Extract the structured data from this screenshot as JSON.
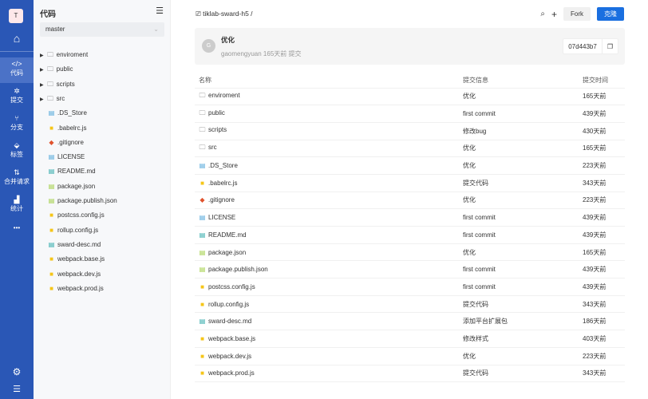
{
  "nav": {
    "logo": "T",
    "items": [
      {
        "label": "代码",
        "icon": "code-icon",
        "glyph": "</>"
      },
      {
        "label": "提交",
        "icon": "pin-icon",
        "glyph": "✲"
      },
      {
        "label": "分支",
        "icon": "branch-icon",
        "glyph": "⑂"
      },
      {
        "label": "标签",
        "icon": "tag-icon",
        "glyph": "⬙"
      },
      {
        "label": "合并请求",
        "icon": "merge-request-icon",
        "glyph": "⇅"
      },
      {
        "label": "统计",
        "icon": "chart-icon",
        "glyph": "▟"
      }
    ],
    "more": "•••"
  },
  "tree": {
    "title": "代码",
    "branch": "master",
    "items": [
      {
        "name": "enviroment",
        "type": "folder"
      },
      {
        "name": "public",
        "type": "folder"
      },
      {
        "name": "scripts",
        "type": "folder"
      },
      {
        "name": "src",
        "type": "folder"
      },
      {
        "name": ".DS_Store",
        "type": "file"
      },
      {
        "name": ".babelrc.js",
        "type": "js"
      },
      {
        "name": ".gitignore",
        "type": "git"
      },
      {
        "name": "LICENSE",
        "type": "file"
      },
      {
        "name": "README.md",
        "type": "md"
      },
      {
        "name": "package.json",
        "type": "json"
      },
      {
        "name": "package.publish.json",
        "type": "json"
      },
      {
        "name": "postcss.config.js",
        "type": "js"
      },
      {
        "name": "rollup.config.js",
        "type": "js"
      },
      {
        "name": "sward-desc.md",
        "type": "md"
      },
      {
        "name": "webpack.base.js",
        "type": "js"
      },
      {
        "name": "webpack.dev.js",
        "type": "js"
      },
      {
        "name": "webpack.prod.js",
        "type": "js"
      }
    ]
  },
  "header": {
    "repo": "tiklab-sward-h5 /",
    "fork": "Fork",
    "clone": "克隆"
  },
  "commit": {
    "avatar": "G",
    "message": "优化",
    "meta": "gaomengyuan 165天前 提交",
    "sha": "07d443b7"
  },
  "table": {
    "headers": [
      "名称",
      "提交信息",
      "提交时间"
    ],
    "rows": [
      [
        "enviroment",
        "优化",
        "165天前"
      ],
      [
        "public",
        "first commit",
        "439天前"
      ],
      [
        "scripts",
        "修改bug",
        "430天前"
      ],
      [
        "src",
        "优化",
        "165天前"
      ],
      [
        ".DS_Store",
        "优化",
        "223天前"
      ],
      [
        ".babelrc.js",
        "提交代码",
        "343天前"
      ],
      [
        ".gitignore",
        "优化",
        "223天前"
      ],
      [
        "LICENSE",
        "first commit",
        "439天前"
      ],
      [
        "README.md",
        "first commit",
        "439天前"
      ],
      [
        "package.json",
        "优化",
        "165天前"
      ],
      [
        "package.publish.json",
        "first commit",
        "439天前"
      ],
      [
        "postcss.config.js",
        "first commit",
        "439天前"
      ],
      [
        "rollup.config.js",
        "提交代码",
        "343天前"
      ],
      [
        "sward-desc.md",
        "添加平台扩展包",
        "186天前"
      ],
      [
        "webpack.base.js",
        "修改样式",
        "403天前"
      ],
      [
        "webpack.dev.js",
        "优化",
        "223天前"
      ],
      [
        "webpack.prod.js",
        "提交代码",
        "343天前"
      ]
    ]
  }
}
